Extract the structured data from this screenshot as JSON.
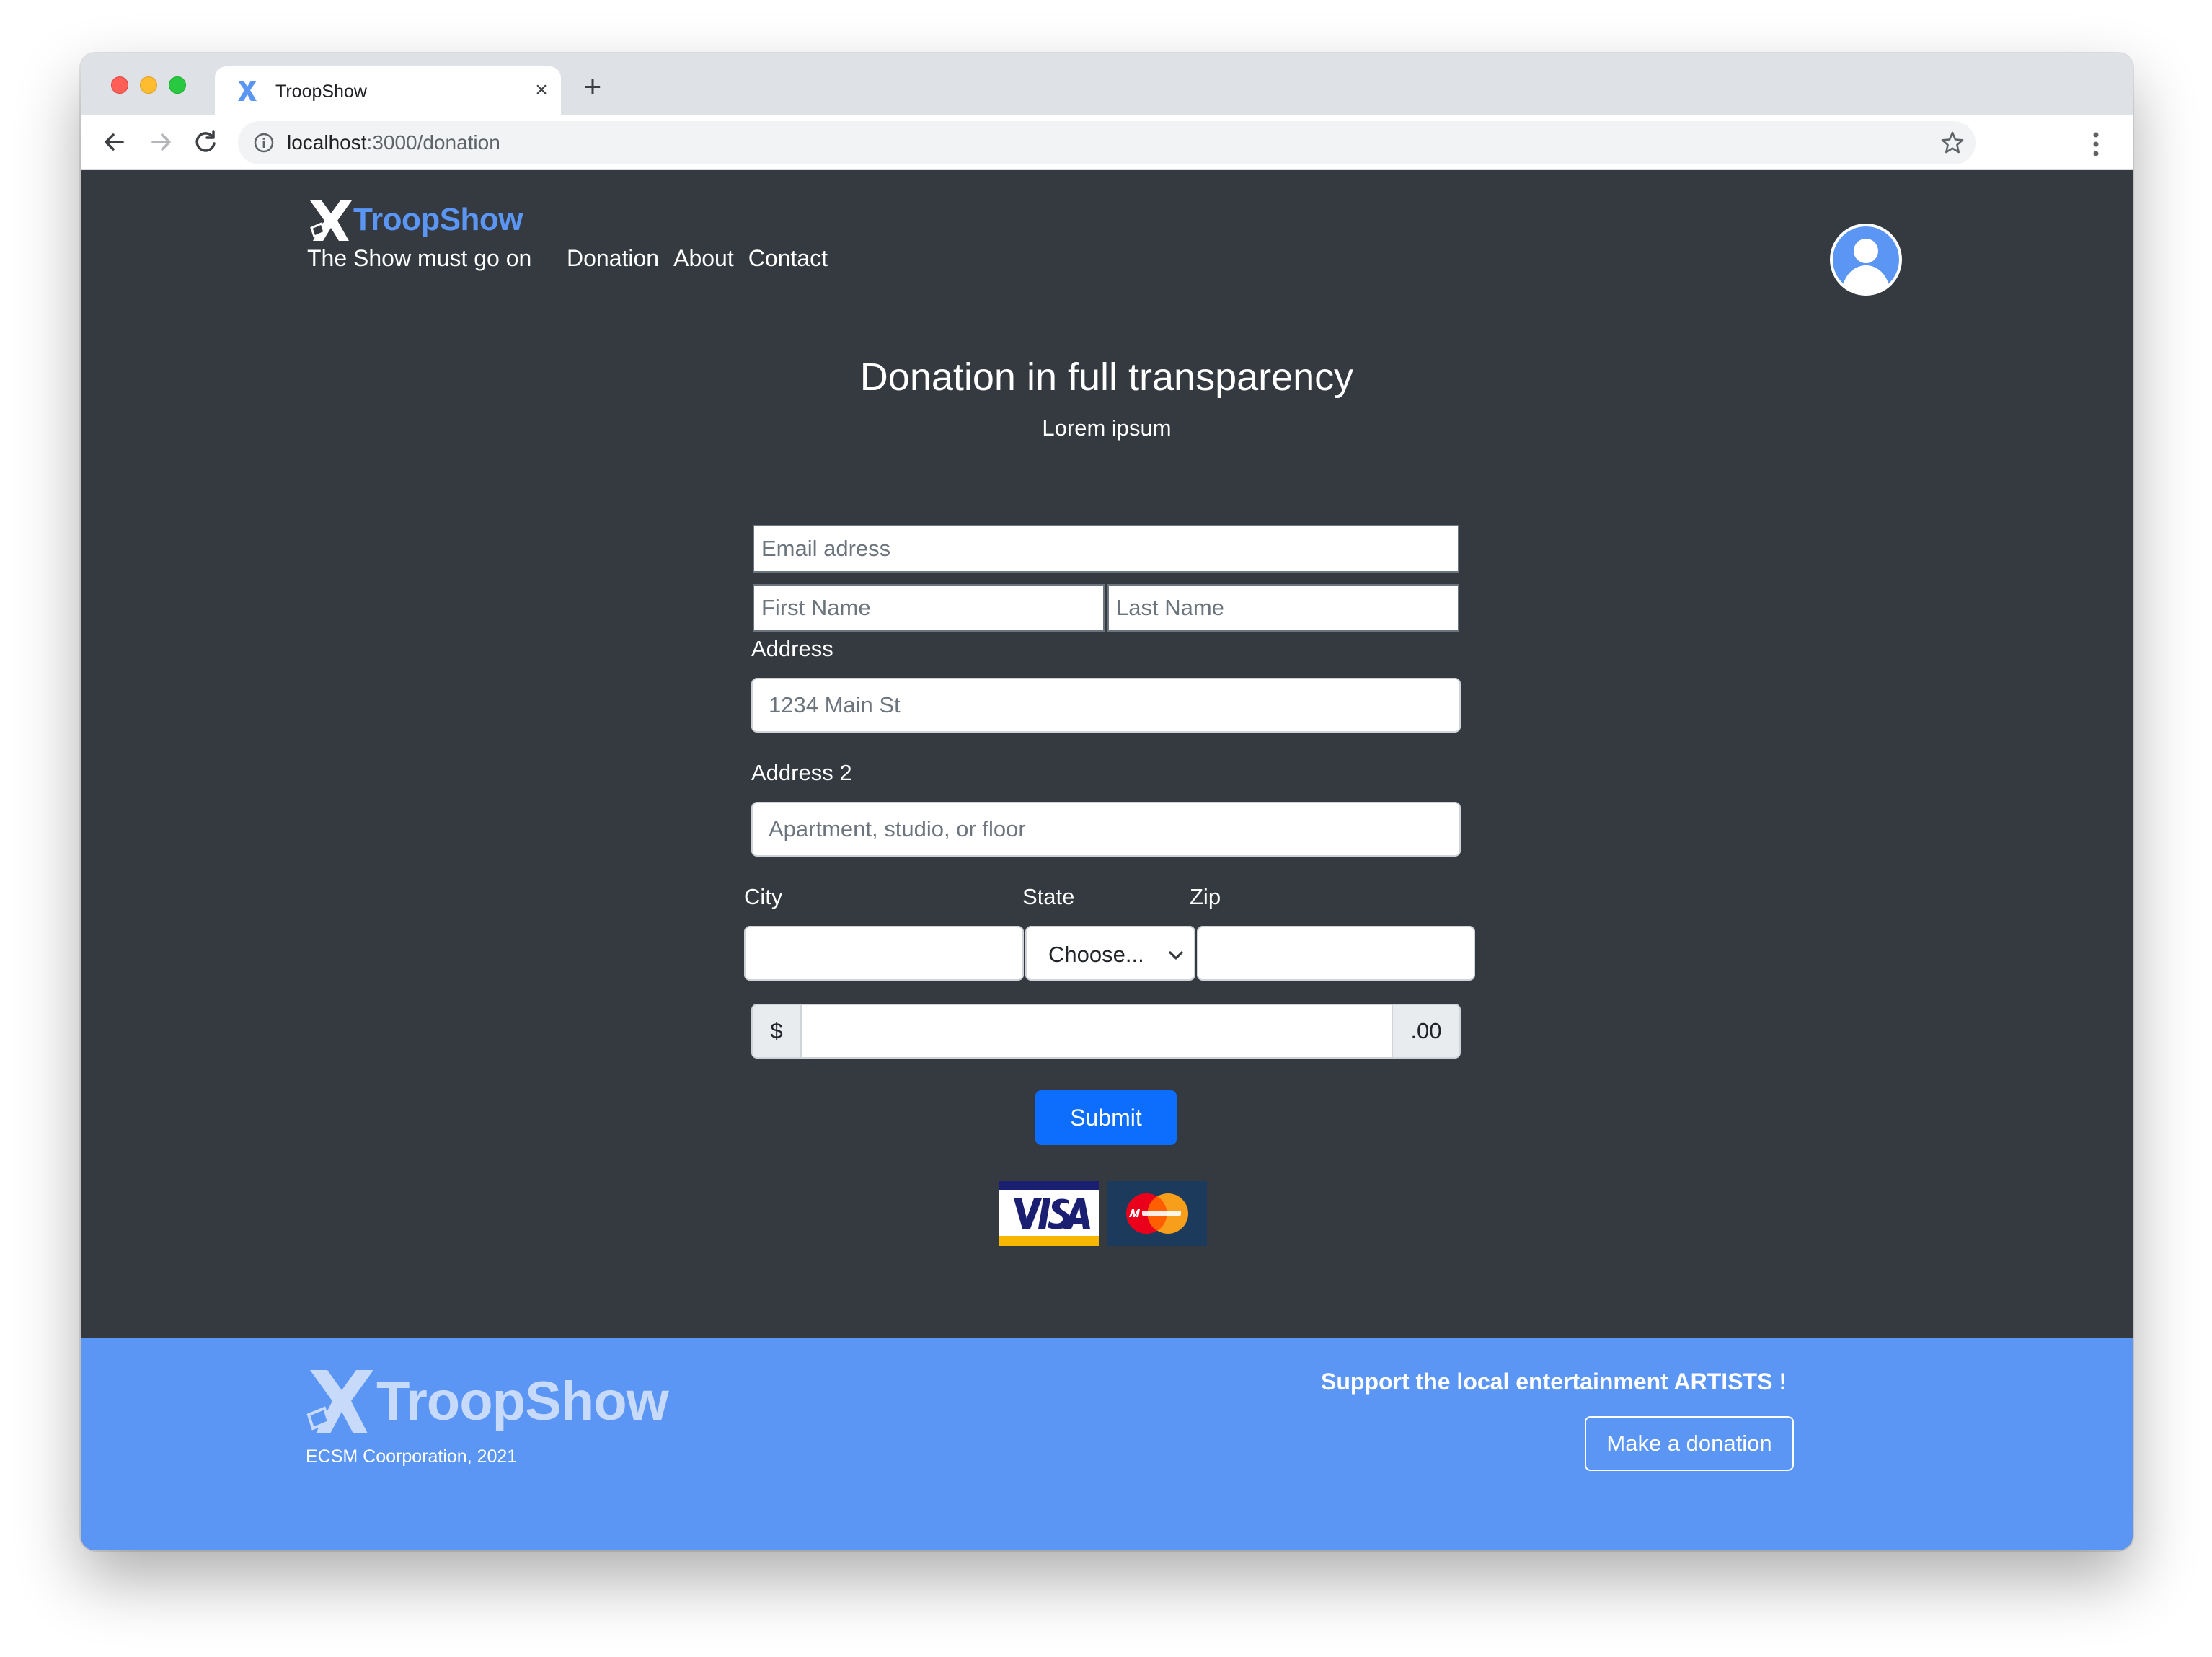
{
  "browser": {
    "tab_title": "TroopShow",
    "close_tab": "×",
    "new_tab": "+",
    "url_host": "localhost",
    "url_path": ":3000/donation"
  },
  "header": {
    "brand_name": "TroopShow",
    "tagline": "The Show must go on",
    "nav": [
      "Donation",
      "About",
      "Contact"
    ],
    "avatar_icon": "user-avatar-icon"
  },
  "form": {
    "title": "Donation in full transparency",
    "subtitle": "Lorem ipsum",
    "email_placeholder": "Email adress",
    "first_name_placeholder": "First Name",
    "last_name_placeholder": "Last Name",
    "address_label": "Address",
    "address_placeholder": "1234 Main St",
    "address2_label": "Address 2",
    "address2_placeholder": "Apartment, studio, or floor",
    "city_label": "City",
    "state_label": "State",
    "zip_label": "Zip",
    "state_selected": "Choose...",
    "currency_prefix": "$",
    "currency_suffix": ".00",
    "submit_label": "Submit",
    "payment_logos": [
      "visa",
      "mastercard"
    ]
  },
  "footer": {
    "brand_name": "TroopShow",
    "copyright": "ECSM Coorporation, 2021",
    "support_text": "Support the local entertainment ARTISTS !",
    "cta_label": "Make a donation"
  },
  "colors": {
    "page_bg": "#343a40",
    "brand_blue": "#5b96f5",
    "primary_button": "#0d6efd",
    "footer_bg": "#5b96f5"
  }
}
